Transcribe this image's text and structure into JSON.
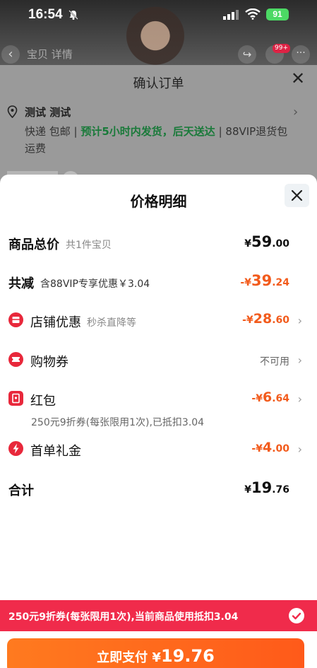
{
  "status_bar": {
    "time": "16:54",
    "battery": "91"
  },
  "background": {
    "nav_title": "宝贝  详情",
    "cart_badge": "99+",
    "confirm_title": "确认订单",
    "address_name": "测试 测试",
    "shipping_prefix": "快递 包邮 | ",
    "shipping_highlight": "预计5小时内发货，后天送达",
    "shipping_suffix": " | 88VIP退货包运费"
  },
  "sheet": {
    "title": "价格明细",
    "total_goods": {
      "label": "商品总价",
      "sub": "共1件宝贝",
      "cur": "¥",
      "int": "59",
      "dec": ".00"
    },
    "total_discount": {
      "label": "共减",
      "sub": "含88VIP专享优惠￥3.04",
      "cur": "-¥",
      "int": "39",
      "dec": ".24"
    },
    "shop_discount": {
      "label": "店铺优惠",
      "sub": "秒杀直降等",
      "cur": "-¥",
      "int": "28",
      "dec": ".60",
      "icon": "shop-icon"
    },
    "shopping_voucher": {
      "label": "购物券",
      "status": "不可用",
      "icon": "ticket-icon"
    },
    "red_packet": {
      "label": "红包",
      "cur": "-¥",
      "int": "6",
      "dec": ".64",
      "note": "250元9折券(每张限用1次),已抵扣3.04",
      "icon": "red-packet-icon"
    },
    "first_order_gift": {
      "label": "首单礼金",
      "cur": "-¥",
      "int": "4",
      "dec": ".00",
      "icon": "lightning-icon"
    },
    "total": {
      "label": "合计",
      "cur": "¥",
      "int": "19",
      "dec": ".76"
    }
  },
  "coupon_bar": {
    "text": "250元9折券(每张限用1次),当前商品使用抵扣3.04"
  },
  "pay_button": {
    "label": "立即支付",
    "cur": "¥",
    "amount": "19.76"
  },
  "colors": {
    "accent_orange": "#f25b1c",
    "coupon_red": "#f02b4b",
    "icon_red": "#e8283b",
    "pay_orange": "#ff6a1d"
  }
}
